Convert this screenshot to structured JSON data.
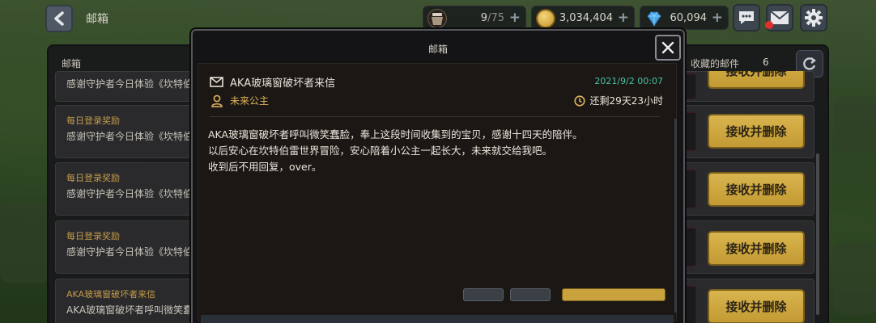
{
  "topbar": {
    "title": "邮箱",
    "stamina": {
      "current": "9",
      "max": "/75",
      "icon": "stamina-pot-icon"
    },
    "gold": {
      "value": "3,034,404",
      "icon": "gold-coin-icon"
    },
    "gems": {
      "value": "60,094",
      "icon": "gem-icon"
    },
    "has_unread_mail": true
  },
  "mailbox": {
    "title": "邮箱",
    "favorites_label": "收藏的邮件",
    "favorites_count": "6",
    "rows": [
      {
        "title": "",
        "body": "感谢守护者今日体验《坎特伯",
        "accept": "接收并删除"
      },
      {
        "title": "每日登录奖励",
        "body": "感谢守护者今日体验《坎特伯",
        "accept": "接收并删除"
      },
      {
        "title": "每日登录奖励",
        "body": "感谢守护者今日体验《坎特伯",
        "accept": "接收并删除"
      },
      {
        "title": "每日登录奖励",
        "body": "感谢守护者今日体验《坎特伯",
        "accept": "接收并删除"
      },
      {
        "title": "AKA玻璃窗破坏者来信",
        "body": "AKA玻璃窗破坏者呼叫微笑蠢",
        "accept": "接收并删除"
      }
    ]
  },
  "modal": {
    "title": "邮箱",
    "subject": "AKA玻璃窗破坏者来信",
    "date": "2021/9/2 00:07",
    "sender": "未来公主",
    "remaining": "还剩29天23小时",
    "body_lines": [
      "AKA玻璃窗破坏者呼叫微笑蠢脸，奉上这段时间收集到的宝贝，感谢十四天的陪伴。",
      "以后安心在坎特伯雷世界冒险，安心陪着小公主一起长大，未来就交给我吧。",
      "收到后不用回复，over。"
    ]
  },
  "colors": {
    "accent_gold": "#c9a23d",
    "date_teal": "#4cc0a4",
    "sender_orange": "#e0b35a",
    "notify_red": "#e0302b"
  }
}
